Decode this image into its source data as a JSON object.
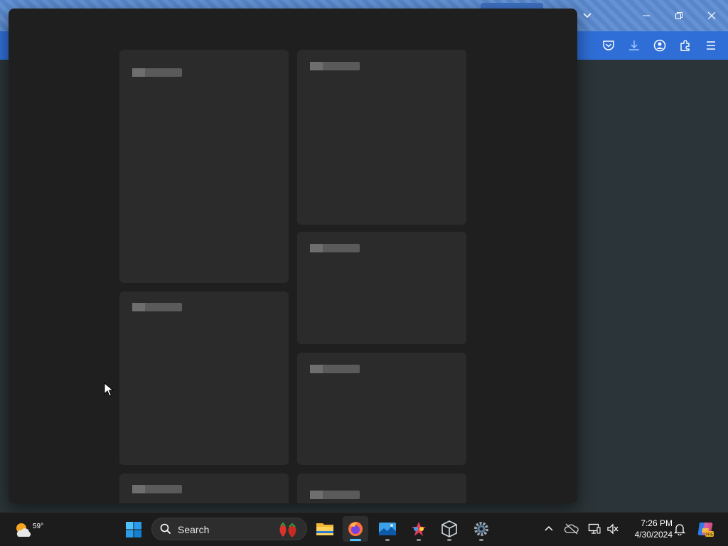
{
  "taskbar": {
    "weather": {
      "temperature": "59°",
      "icon": "weather-partly-cloudy-icon"
    },
    "search": {
      "placeholder": "Search"
    },
    "pinned_apps": [
      {
        "name": "start-button",
        "icon": "windows-logo-icon"
      },
      {
        "name": "file-explorer",
        "icon": "folder-icon"
      },
      {
        "name": "firefox",
        "icon": "firefox-icon",
        "active": true
      },
      {
        "name": "photos-app",
        "icon": "photos-icon"
      },
      {
        "name": "paint-app",
        "icon": "paint-icon"
      },
      {
        "name": "virtualbox",
        "icon": "cube-icon"
      },
      {
        "name": "settings",
        "icon": "gear-icon"
      }
    ],
    "clock": {
      "time": "7:26 PM",
      "date": "4/30/2024"
    }
  },
  "browser": {
    "toolbar_icons": [
      "pocket-icon",
      "download-icon",
      "account-icon",
      "extensions-icon",
      "menu-icon"
    ]
  },
  "colors": {
    "titlebar": "#5b8bd1",
    "toolbar": "#2f6ed6",
    "overlay": "#1f1f1f",
    "card": "#2b2b2b",
    "taskbar": "#1c1c1c",
    "accent": "#4cc2ff"
  }
}
